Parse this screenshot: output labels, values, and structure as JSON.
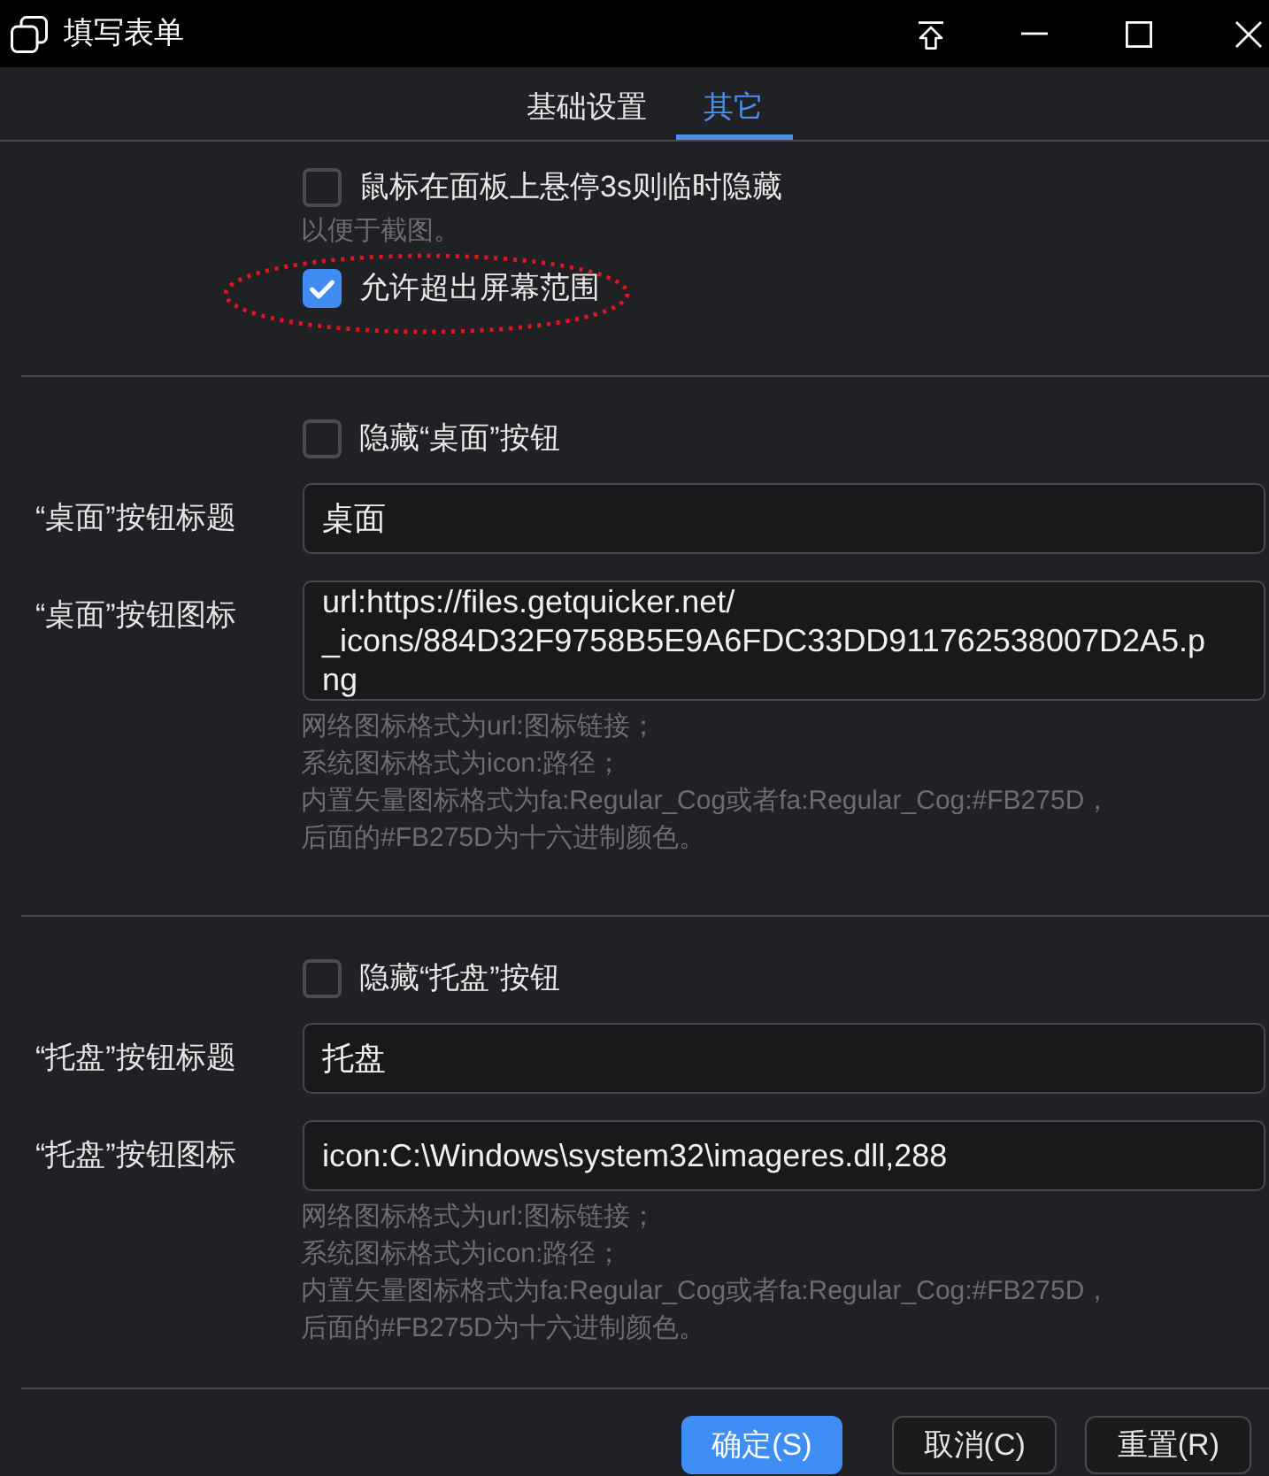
{
  "window": {
    "title": "填写表单"
  },
  "tabs": [
    {
      "label": "基础设置",
      "selected": false
    },
    {
      "label": "其它",
      "selected": true
    }
  ],
  "sections": [
    {
      "rows": [
        {
          "kind": "checkbox",
          "label": "鼠标在面板上悬停3s则临时隐藏",
          "checked": false,
          "circled": false
        },
        {
          "kind": "note",
          "lines": [
            "以便于截图。"
          ]
        },
        {
          "kind": "checkbox",
          "label": "允许超出屏幕范围",
          "checked": true,
          "circled": true
        }
      ]
    },
    {
      "rows": [
        {
          "kind": "checkbox",
          "label": "隐藏“桌面”按钮",
          "checked": false,
          "circled": false
        },
        {
          "kind": "field",
          "label": "“桌面”按钮标题",
          "value_lines": [
            "桌面"
          ]
        },
        {
          "kind": "field",
          "label": "“桌面”按钮图标",
          "value_lines": [
            "url:https://files.getquicker.net/",
            "_icons/884D32F9758B5E9A6FDC33DD911762538007D2A5.p",
            "ng"
          ]
        },
        {
          "kind": "note",
          "lines": [
            "网络图标格式为url:图标链接；",
            "系统图标格式为icon:路径；",
            "内置矢量图标格式为fa:Regular_Cog或者fa:Regular_Cog:#FB275D，",
            "后面的#FB275D为十六进制颜色。"
          ]
        }
      ]
    },
    {
      "rows": [
        {
          "kind": "checkbox",
          "label": "隐藏“托盘”按钮",
          "checked": false,
          "circled": false
        },
        {
          "kind": "field",
          "label": "“托盘”按钮标题",
          "value_lines": [
            "托盘"
          ]
        },
        {
          "kind": "field",
          "label": "“托盘”按钮图标",
          "value_lines": [
            "icon:C:\\Windows\\system32\\imageres.dll,288"
          ]
        },
        {
          "kind": "note",
          "lines": [
            "网络图标格式为url:图标链接；",
            "系统图标格式为icon:路径；",
            "内置矢量图标格式为fa:Regular_Cog或者fa:Regular_Cog:#FB275D，",
            "后面的#FB275D为十六进制颜色。"
          ]
        }
      ]
    }
  ],
  "buttons": [
    {
      "label": "确定(S)",
      "kind": "primary"
    },
    {
      "label": "取消(C)",
      "kind": "secondary"
    },
    {
      "label": "重置(R)",
      "kind": "secondary"
    }
  ]
}
